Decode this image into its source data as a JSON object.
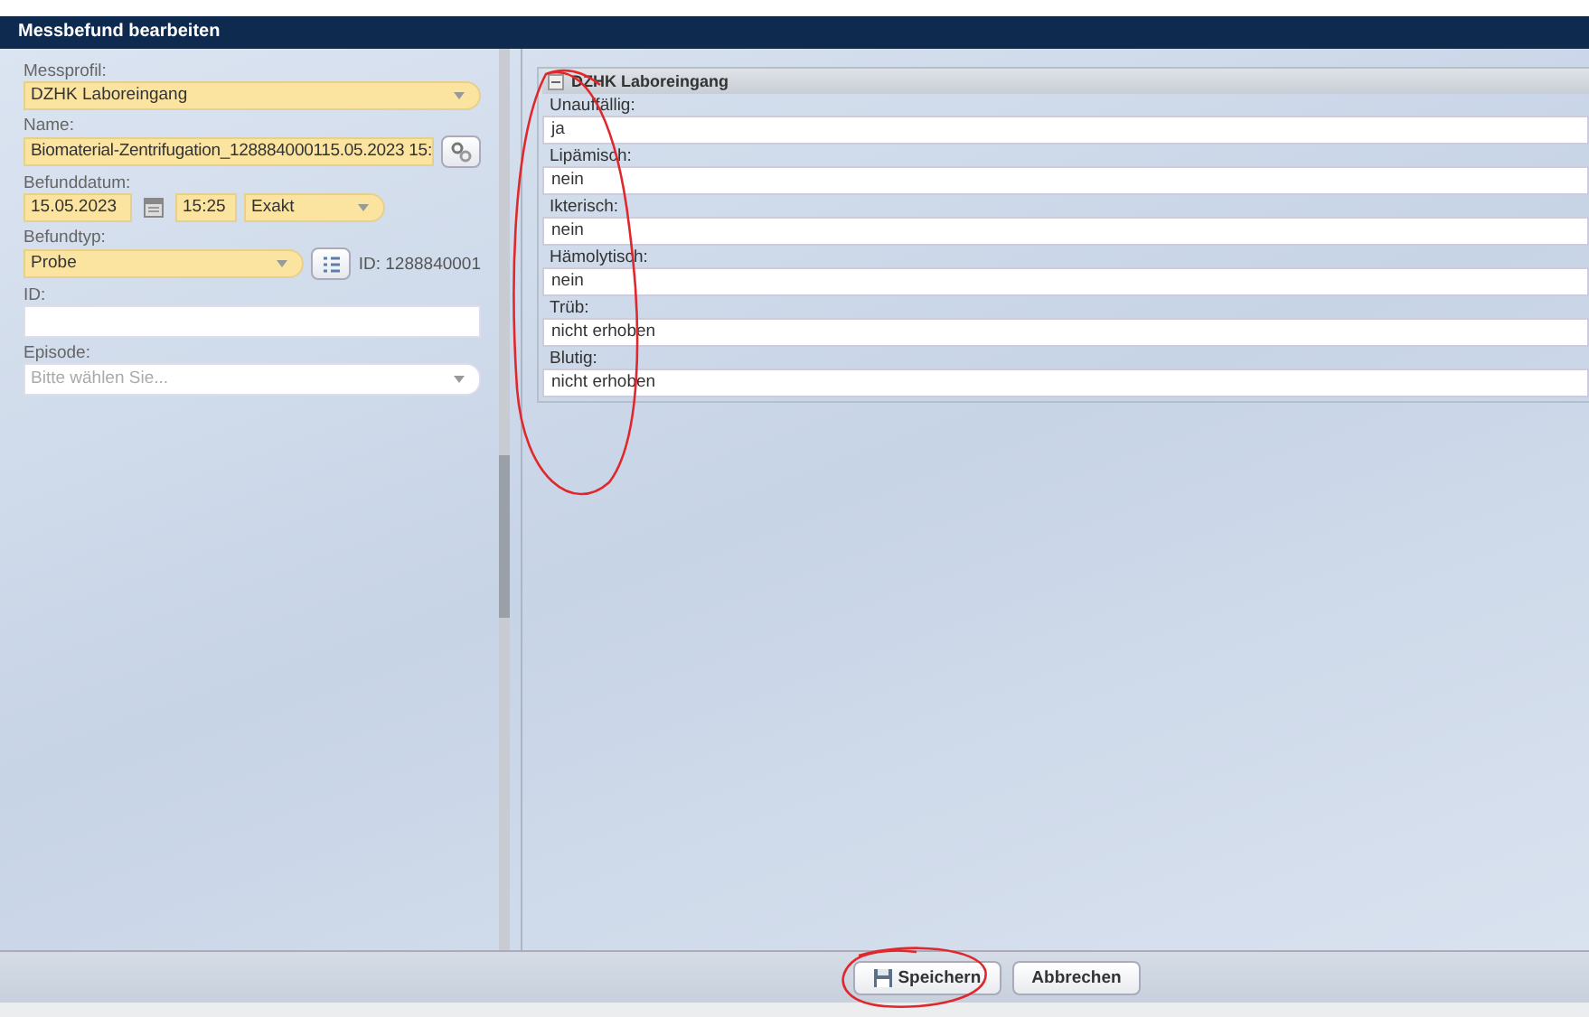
{
  "window": {
    "title": "Messbefund bearbeiten"
  },
  "form": {
    "messprofil": {
      "label": "Messprofil:",
      "value": "DZHK Laboreingang"
    },
    "name": {
      "label": "Name:",
      "value": "Biomaterial-Zentrifugation_128884000115.05.2023 15:"
    },
    "befunddatum": {
      "label": "Befunddatum:",
      "date": "15.05.2023",
      "time": "15:25",
      "precision": "Exakt"
    },
    "befundtyp": {
      "label": "Befundtyp:",
      "value": "Probe",
      "id_text": "ID: 1288840001"
    },
    "id": {
      "label": "ID:"
    },
    "episode": {
      "label": "Episode:",
      "placeholder": "Bitte wählen Sie..."
    }
  },
  "group": {
    "title": "DZHK Laboreingang",
    "expanded": true,
    "fields": [
      {
        "label": "Unauffällig:",
        "value": "ja"
      },
      {
        "label": "Lipämisch:",
        "value": "nein"
      },
      {
        "label": "Ikterisch:",
        "value": "nein"
      },
      {
        "label": "Hämolytisch:",
        "value": "nein"
      },
      {
        "label": "Trüb:",
        "value": "nicht erhoben"
      },
      {
        "label": "Blutig:",
        "value": "nicht erhoben"
      }
    ]
  },
  "buttons": [
    {
      "kind": "save",
      "label": "Speichern"
    },
    {
      "kind": "cancel",
      "label": "Abbrechen"
    }
  ]
}
